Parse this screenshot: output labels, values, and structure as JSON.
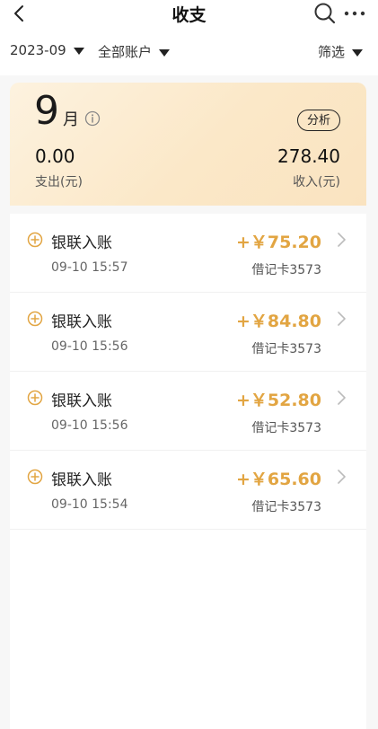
{
  "header": {
    "title": "收支",
    "back_icon": "chevron-left-icon",
    "search_icon": "search-icon",
    "more_icon": "more-dots-icon"
  },
  "filters": {
    "date": "2023-09",
    "account": "全部账户",
    "filter": "筛选"
  },
  "summary": {
    "month_number": "9",
    "month_unit": "月",
    "analyze_label": "分析",
    "expense_value": "0.00",
    "expense_label": "支出(元)",
    "income_value": "278.40",
    "income_label": "收入(元)"
  },
  "transactions": [
    {
      "title": "银联入账",
      "time": "09-10 15:57",
      "amount": "+￥75.20",
      "card": "借记卡3573"
    },
    {
      "title": "银联入账",
      "time": "09-10 15:56",
      "amount": "+￥84.80",
      "card": "借记卡3573"
    },
    {
      "title": "银联入账",
      "time": "09-10 15:56",
      "amount": "+￥52.80",
      "card": "借记卡3573"
    },
    {
      "title": "银联入账",
      "time": "09-10 15:54",
      "amount": "+￥65.60",
      "card": "借记卡3573"
    }
  ],
  "colors": {
    "income_amount": "#e2a542",
    "card_gradient_start": "#fdf2df",
    "card_gradient_end": "#fae3c0"
  }
}
